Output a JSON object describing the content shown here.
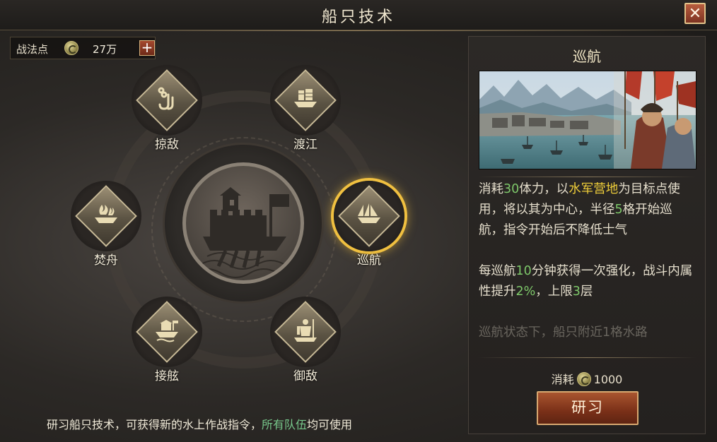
{
  "header": {
    "title": "船只技术",
    "close_icon": "close-icon"
  },
  "points": {
    "label": "战法点",
    "icon": "coin-icon",
    "value": "27万",
    "add_icon": "plus-icon"
  },
  "nodes": [
    {
      "label": "掠敌",
      "icon": "chain-hook-icon"
    },
    {
      "label": "渡江",
      "icon": "junk-ship-icon"
    },
    {
      "label": "焚舟",
      "icon": "burning-ship-icon"
    },
    {
      "label": "巡航",
      "icon": "sailing-ship-icon",
      "selected": true
    },
    {
      "label": "接舷",
      "icon": "boarding-ship-icon"
    },
    {
      "label": "御敌",
      "icon": "armored-soldier-icon"
    }
  ],
  "center": {
    "icon": "warship-icon"
  },
  "panel": {
    "title": "巡航",
    "desc1": {
      "a": "消耗",
      "b": "30",
      "c": "体力，以",
      "d": "水军营地",
      "e": "为目标点使用，将以其为中心，半径",
      "f": "5",
      "g": "格开始巡航，指令开始后不降低士气"
    },
    "desc2": {
      "a": "每巡航",
      "b": "10",
      "c": "分钟获得一次强化，战斗内属性提升",
      "d": "2%",
      "e": "，上限",
      "f": "3",
      "g": "层"
    },
    "desc3": "巡航状态下，船只附近1格水路",
    "cost_label": "消耗",
    "cost_value": "1000",
    "button_label": "研习"
  },
  "footer": {
    "a": "研习船只技术，可获得新的水上作战指令，",
    "b": "所有队伍",
    "c": "均可使用"
  },
  "colors": {
    "highlight_yellow": "#f0cf3a",
    "number_green": "#7ec86a",
    "selected_ring": "#f0c040",
    "button_red": "#7a3018"
  }
}
